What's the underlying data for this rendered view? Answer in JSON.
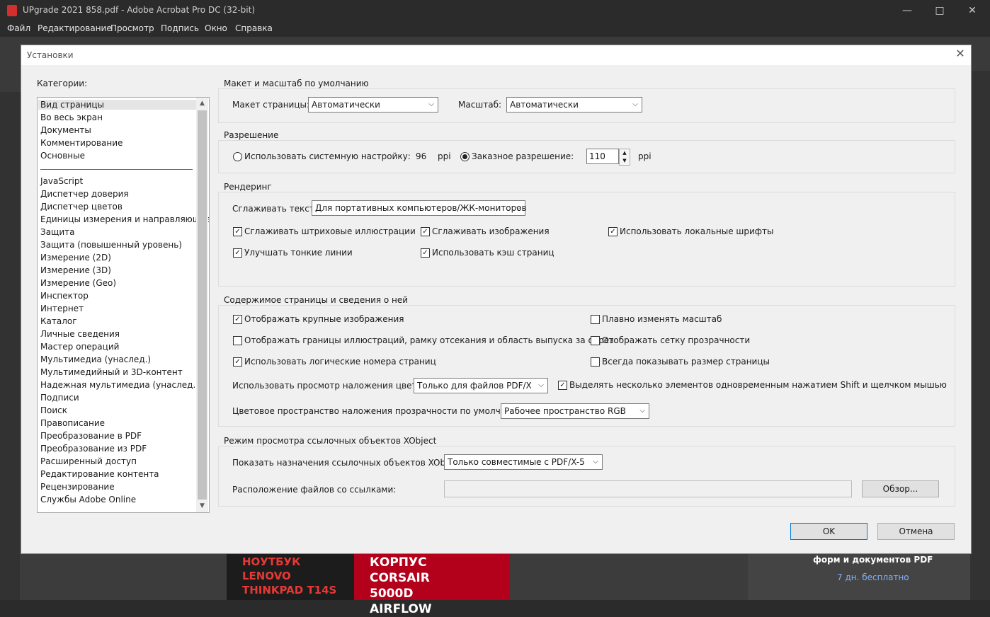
{
  "app": {
    "title": "UPgrade 2021 858.pdf - Adobe Acrobat Pro DC (32-bit)",
    "menu": [
      "Файл",
      "Редактирование",
      "Просмотр",
      "Подпись",
      "Окно",
      "Справка"
    ],
    "background": {
      "ad1_text": "НОУТБУК LENOVO THINKPAD T14S",
      "ad2_text": "КОРПУС CORSAIR 5000D AIRFLOW",
      "promo_text": "форм и документов PDF",
      "promo_link": "7 дн. бесплатно"
    }
  },
  "dialog": {
    "title": "Установки",
    "categories_label": "Категории:",
    "categories_top": [
      "Вид страницы",
      "Во весь экран",
      "Документы",
      "Комментирование",
      "Основные"
    ],
    "categories": [
      "JavaScript",
      "Диспетчер доверия",
      "Диспетчер цветов",
      "Единицы измерения и направляющие",
      "Защита",
      "Защита (повышенный уровень)",
      "Измерение (2D)",
      "Измерение (3D)",
      "Измерение (Geo)",
      "Инспектор",
      "Интернет",
      "Каталог",
      "Личные сведения",
      "Мастер операций",
      "Мультимедиа (унаслед.)",
      "Мультимедийный и 3D-контент",
      "Надежная мультимедиа (унаслед.)",
      "Подписи",
      "Поиск",
      "Правописание",
      "Преобразование в PDF",
      "Преобразование из PDF",
      "Расширенный доступ",
      "Редактирование контента",
      "Рецензирование",
      "Службы Adobe Online"
    ],
    "layout_group": {
      "title": "Макет и масштаб по умолчанию",
      "page_layout_label": "Макет страницы:",
      "page_layout_value": "Автоматически",
      "zoom_label": "Масштаб:",
      "zoom_value": "Автоматически"
    },
    "resolution_group": {
      "title": "Разрешение",
      "system_label": "Использовать системную настройку:",
      "system_value": "96",
      "system_unit": "ppi",
      "custom_label": "Заказное разрешение:",
      "custom_value": "110",
      "custom_unit": "ppi"
    },
    "rendering_group": {
      "title": "Рендеринг",
      "smooth_text_label": "Сглаживать текст:",
      "smooth_text_value": "Для портативных компьютеров/ЖК-мониторов",
      "smooth_line_art": "Сглаживать штриховые иллюстрации",
      "smooth_images": "Сглаживать изображения",
      "local_fonts": "Использовать локальные шрифты",
      "enhance_thin_lines": "Улучшать тонкие линии",
      "page_cache": "Использовать кэш страниц"
    },
    "content_group": {
      "title": "Содержимое страницы и сведения о ней",
      "show_large_images": "Отображать крупные изображения",
      "smooth_zoom": "Плавно изменять масштаб",
      "show_art_boxes": "Отображать границы иллюстраций, рамку отсекания и область выпуска за обрез",
      "show_transparency_grid": "Отображать сетку прозрачности",
      "logical_page_numbers": "Использовать логические номера страниц",
      "always_show_page_size": "Всегда показывать размер страницы",
      "overprint_label": "Использовать просмотр наложения цветов:",
      "overprint_value": "Только для файлов PDF/X",
      "multi_select": "Выделять несколько элементов одновременным нажатием Shift и щелчком мышью",
      "blend_space_label": "Цветовое пространство наложения прозрачности по умолчанию:",
      "blend_space_value": "Рабочее пространство RGB"
    },
    "xobject_group": {
      "title": "Режим просмотра ссылочных объектов XObject",
      "show_targets_label": "Показать назначения ссылочных объектов XObject:",
      "show_targets_value": "Только совместимые с PDF/X-5",
      "location_label": "Расположение файлов со ссылками:",
      "location_value": "",
      "browse_button": "Обзор..."
    },
    "ok_button": "OK",
    "cancel_button": "Отмена"
  }
}
